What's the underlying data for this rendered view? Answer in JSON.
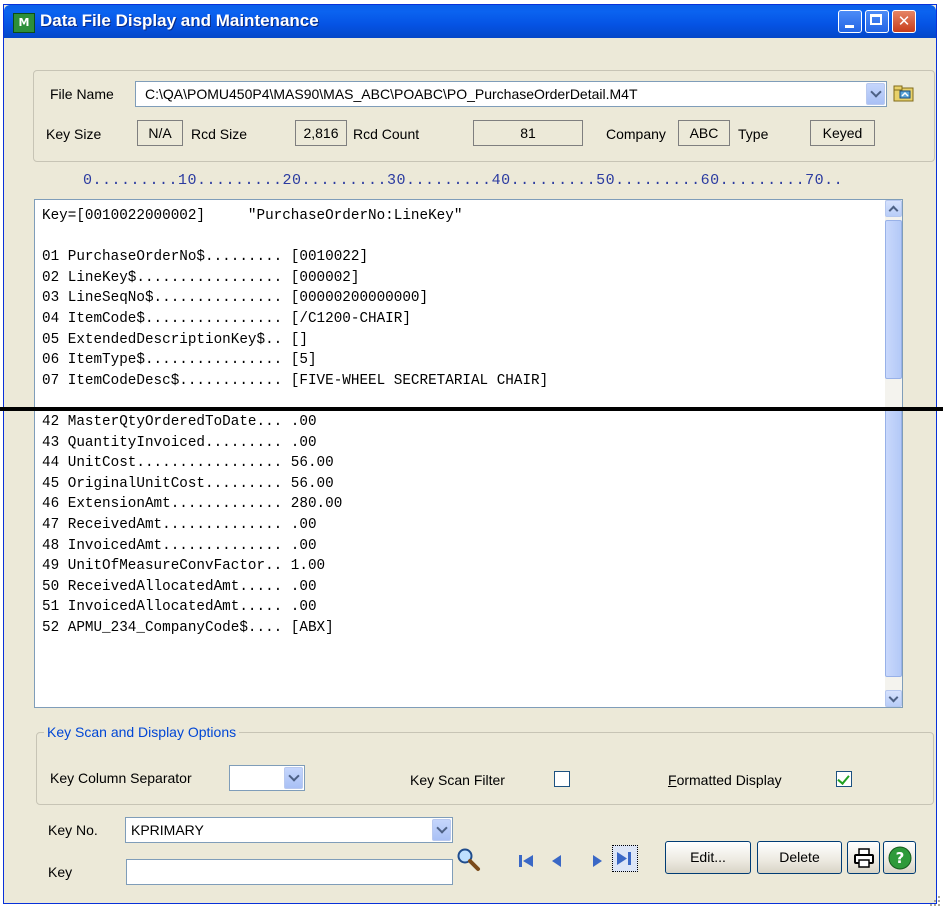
{
  "window": {
    "title": "Data File Display and Maintenance",
    "app_icon_text": "M"
  },
  "file_info": {
    "file_name_label": "File Name",
    "file_name_value": "C:\\QA\\POMU450P4\\MAS90\\MAS_ABC\\POABC\\PO_PurchaseOrderDetail.M4T",
    "key_size_label": "Key Size",
    "key_size_value": "N/A",
    "rcd_size_label": "Rcd Size",
    "rcd_size_value": "2,816",
    "rcd_count_label": "Rcd Count",
    "rcd_count_value": "81",
    "company_label": "Company",
    "company_value": "ABC",
    "type_label": "Type",
    "type_value": "Keyed"
  },
  "ruler": "0.........10.........20.........30.........40.........50.........60.........70..",
  "record_top": [
    "Key=[0010022000002]     \"PurchaseOrderNo:LineKey\"",
    "",
    "01 PurchaseOrderNo$......... [0010022]",
    "02 LineKey$................. [000002]",
    "03 LineSeqNo$............... [00000200000000]",
    "04 ItemCode$................ [/C1200-CHAIR]",
    "05 ExtendedDescriptionKey$.. []",
    "06 ItemType$................ [5]",
    "07 ItemCodeDesc$............ [FIVE-WHEEL SECRETARIAL CHAIR]"
  ],
  "record_bottom": [
    "42 MasterQtyOrderedToDate... .00",
    "43 QuantityInvoiced......... .00",
    "44 UnitCost................. 56.00",
    "45 OriginalUnitCost......... 56.00",
    "46 ExtensionAmt............. 280.00",
    "47 ReceivedAmt.............. .00",
    "48 InvoicedAmt.............. .00",
    "49 UnitOfMeasureConvFactor.. 1.00",
    "50 ReceivedAllocatedAmt..... .00",
    "51 InvoicedAllocatedAmt..... .00",
    "52 APMU_234_CompanyCode$.... [ABX]"
  ],
  "options": {
    "group_title": "Key Scan and Display Options",
    "key_column_separator_label": "Key Column Separator",
    "key_column_separator_value": "",
    "key_scan_filter_label": "Key Scan Filter",
    "key_scan_filter_checked": false,
    "formatted_display_label": "Formatted Display",
    "formatted_display_checked": true
  },
  "key_controls": {
    "key_no_label": "Key No.",
    "key_no_value": "KPRIMARY",
    "key_label": "Key",
    "key_value": ""
  },
  "buttons": {
    "edit": "Edit...",
    "delete": "Delete"
  },
  "icons": [
    "app-icon",
    "minimize-icon",
    "maximize-icon",
    "close-icon",
    "browse-folder-icon",
    "search-icon",
    "first-record-icon",
    "previous-record-icon",
    "next-record-icon",
    "last-record-icon",
    "printer-icon",
    "help-icon"
  ]
}
